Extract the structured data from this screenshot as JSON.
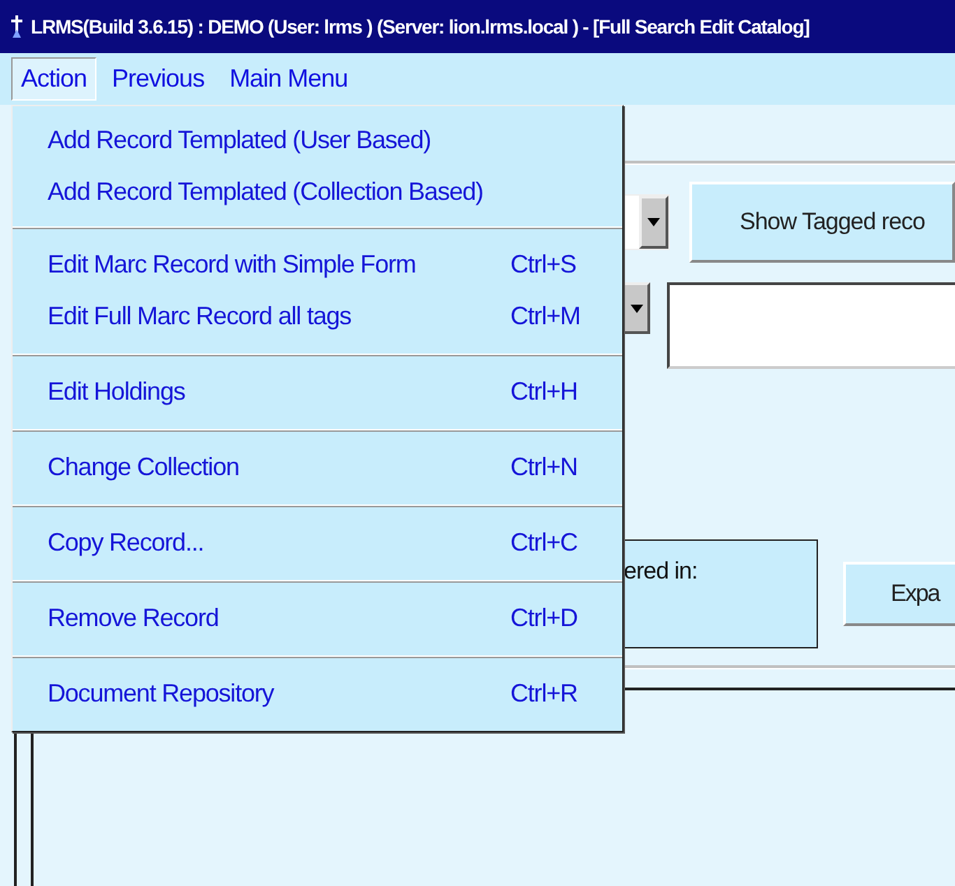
{
  "window": {
    "title": "LRMS(Build 3.6.15) : DEMO (User: lrms ) (Server: lion.lrms.local ) - [Full Search Edit Catalog]"
  },
  "menubar": [
    {
      "label": "Action",
      "selected": true
    },
    {
      "label": "Previous",
      "selected": false
    },
    {
      "label": "Main Menu",
      "selected": false
    }
  ],
  "menu": {
    "groups": [
      {
        "items": [
          {
            "label": "Add Record Templated (User Based)"
          },
          {
            "label": "Add Record Templated (Collection Based)"
          }
        ]
      },
      {
        "items": [
          {
            "label": "Edit Marc Record with Simple Form",
            "shortcut": "Ctrl+S"
          },
          {
            "label": "Edit Full Marc Record all tags",
            "shortcut": "Ctrl+M"
          }
        ]
      },
      {
        "items": [
          {
            "label": "Edit Holdings",
            "shortcut": "Ctrl+H"
          }
        ]
      },
      {
        "items": [
          {
            "label": "Change Collection",
            "shortcut": "Ctrl+N"
          }
        ]
      },
      {
        "items": [
          {
            "label": "Copy Record...",
            "shortcut": "Ctrl+C"
          }
        ]
      },
      {
        "items": [
          {
            "label": "Remove Record",
            "shortcut": "Ctrl+D"
          }
        ]
      },
      {
        "items": [
          {
            "label": "Document Repository",
            "shortcut": "Ctrl+R"
          }
        ]
      }
    ]
  },
  "form": {
    "show_tagged_button": "Show Tagged reco",
    "frame_label": "ered in:",
    "expand_button": "Expa"
  }
}
